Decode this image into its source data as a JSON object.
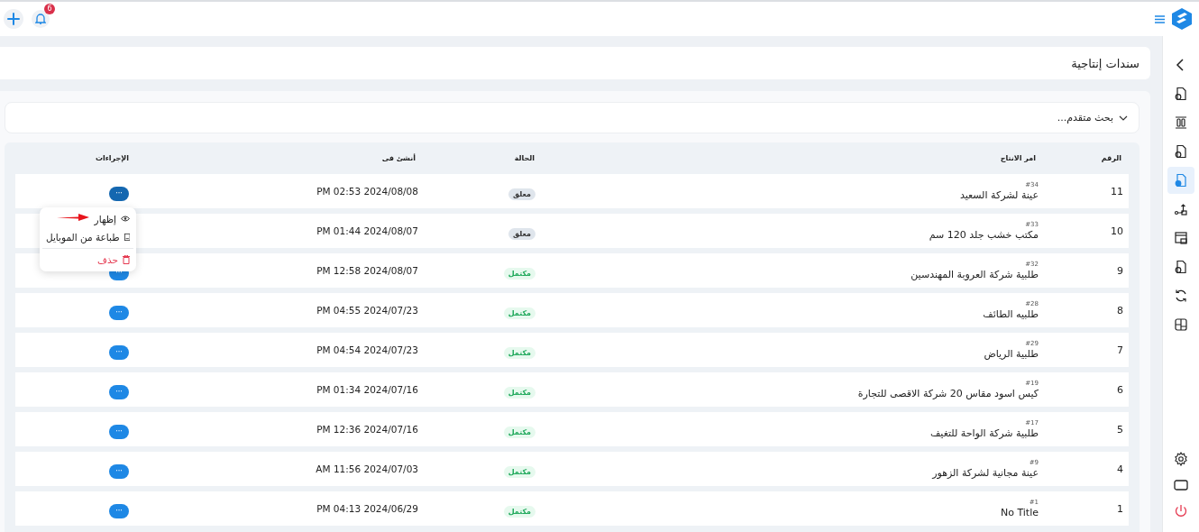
{
  "topbar": {
    "notification_count": "6"
  },
  "sidebar": {
    "items": [
      {
        "selected": false
      },
      {
        "selected": false
      },
      {
        "selected": false
      },
      {
        "selected": false
      },
      {
        "selected": true
      },
      {
        "selected": false
      },
      {
        "selected": false
      },
      {
        "selected": false
      },
      {
        "selected": false
      },
      {
        "selected": false
      }
    ]
  },
  "page": {
    "title": "سندات إنتاجية"
  },
  "search": {
    "label": "بحث متقدم...",
    "expanded": false
  },
  "table": {
    "columns": [
      "الرقم",
      "امر الانتاج",
      "الحالة",
      "أنشئ فى",
      "الإجراءات"
    ],
    "rows": [
      {
        "number": "11",
        "code": "#34",
        "name": "عينة لشركة السعيد",
        "status": "معلق",
        "kind": "pending",
        "created": "PM 02:53 2024/08/08",
        "action": "···",
        "selected": true
      },
      {
        "number": "10",
        "code": "#33",
        "name": "مكتب خشب جلد 120 سم",
        "status": "معلق",
        "kind": "pending",
        "created": "PM 01:44 2024/08/07",
        "selected": false
      },
      {
        "number": "9",
        "code": "#32",
        "name": "طلبية شركة العروبة المهندسين",
        "status": "مكتمل",
        "kind": "done",
        "created": "PM 12:58 2024/08/07",
        "action": "···",
        "selected": false
      },
      {
        "number": "8",
        "code": "#28",
        "name": "طلبيه الطائف",
        "status": "مكتمل",
        "kind": "done",
        "created": "PM 04:55 2024/07/23",
        "action": "···",
        "selected": false
      },
      {
        "number": "7",
        "code": "#29",
        "name": "طلبية الرياض",
        "status": "مكتمل",
        "kind": "done",
        "created": "PM 04:54 2024/07/23",
        "action": "···",
        "selected": false
      },
      {
        "number": "6",
        "code": "#19",
        "name": "كيس اسود مقاس 20 شركة الاقصى للتجارة",
        "status": "مكتمل",
        "kind": "done",
        "created": "PM 01:34 2024/07/16",
        "action": "···",
        "selected": false
      },
      {
        "number": "5",
        "code": "#17",
        "name": "طلبية شركة الواحة للتغيف",
        "status": "مكتمل",
        "kind": "done",
        "created": "PM 12:36 2024/07/16",
        "action": "···",
        "selected": false
      },
      {
        "number": "4",
        "code": "#9",
        "name": "عينة مجانية لشركة الزهور",
        "status": "مكتمل",
        "kind": "done",
        "created": "AM 11:56 2024/07/03",
        "action": "···",
        "selected": false
      },
      {
        "number": "1",
        "code": "#1",
        "name": "No Title",
        "status": "مكتمل",
        "kind": "done",
        "created": "PM 04:13 2024/06/29",
        "action": "···",
        "selected": false
      }
    ]
  },
  "action_menu": {
    "items": [
      {
        "label": "إظهار",
        "kind": "view"
      },
      {
        "label": "طباعة من الموبايل",
        "kind": "print"
      },
      {
        "label": "حذف",
        "kind": "delete"
      }
    ]
  }
}
